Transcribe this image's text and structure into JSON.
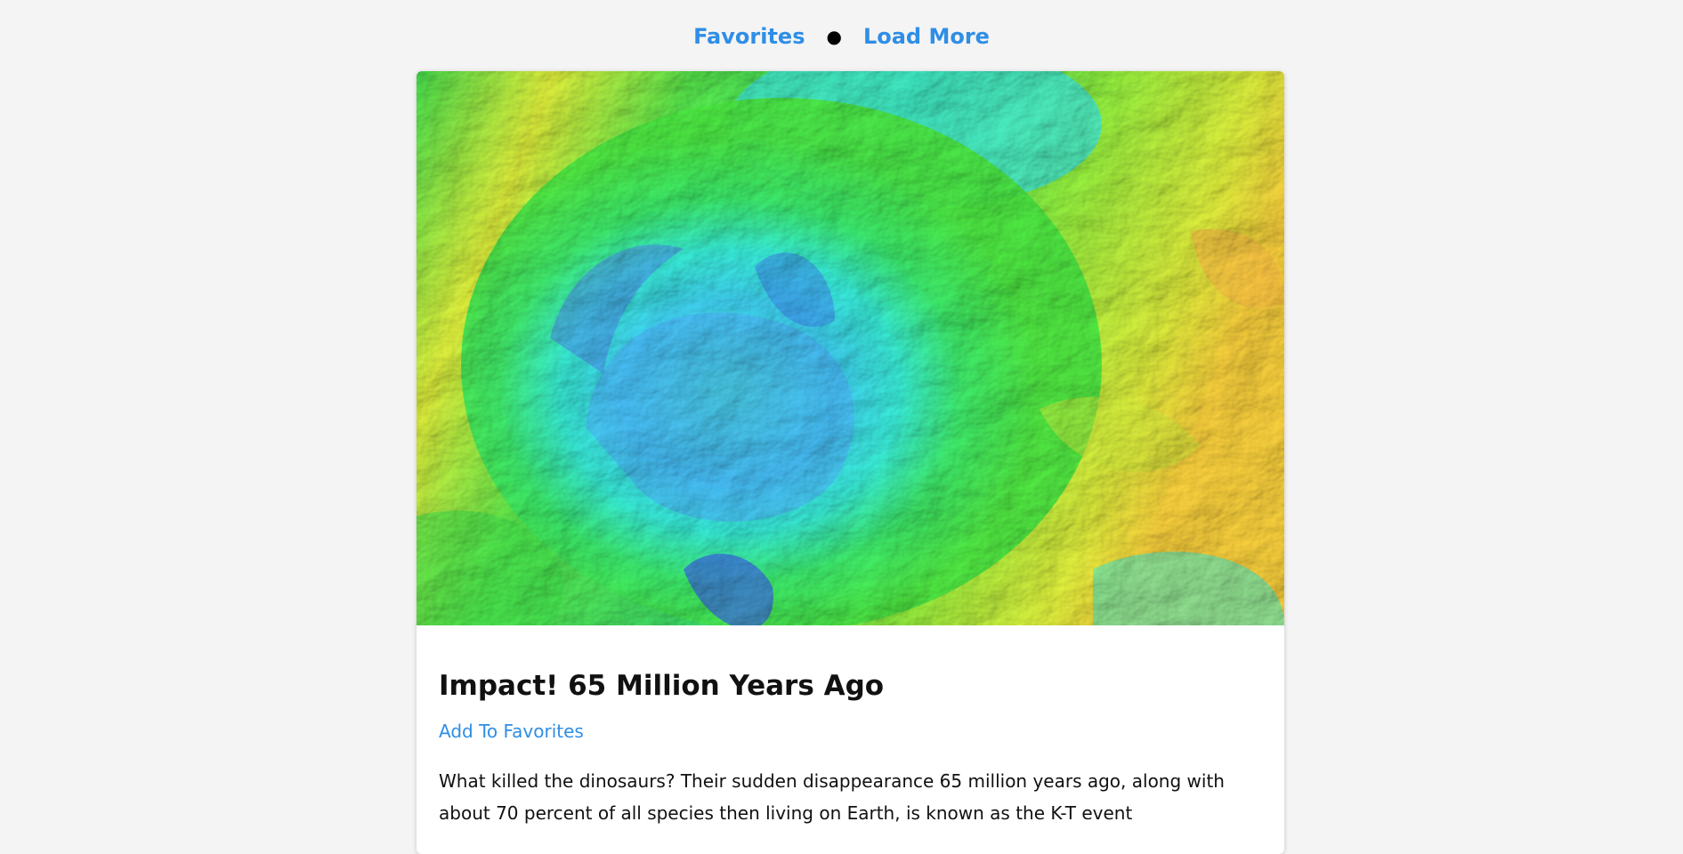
{
  "nav": {
    "favorites_label": "Favorites",
    "separator": "●",
    "load_more_label": "Load More"
  },
  "article": {
    "image_alt": "Impact! 65 Million Years Ago",
    "title": "Impact! 65 Million Years Ago",
    "add_favorite_label": "Add To Favorites",
    "description": "What killed the dinosaurs? Their sudden disappearance 65 million years ago, along with about 70 percent of all species then living on Earth, is known as the K-T event"
  },
  "colors": {
    "link": "#2f8ee5",
    "background": "#f4f4f4"
  }
}
